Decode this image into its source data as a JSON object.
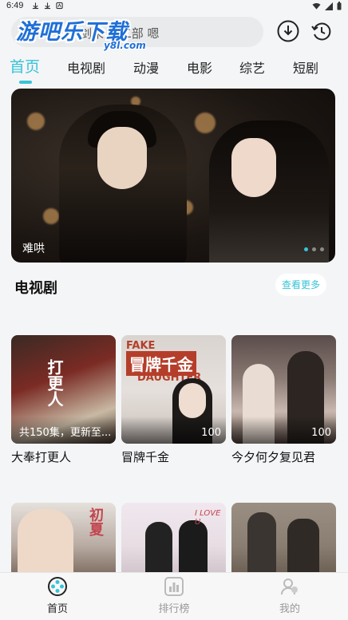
{
  "status_bar": {
    "time": "6:49"
  },
  "header": {
    "logo_text": "游吧乐下载",
    "logo_sub": "y8l.com",
    "search_placeholder": "剑来 第二部 嗯"
  },
  "tabs": [
    {
      "label": "首页",
      "active": true
    },
    {
      "label": "电视剧",
      "active": false
    },
    {
      "label": "动漫",
      "active": false
    },
    {
      "label": "电影",
      "active": false
    },
    {
      "label": "综艺",
      "active": false
    },
    {
      "label": "短剧",
      "active": false
    }
  ],
  "banner": {
    "caption": "难哄",
    "slide_index": 1,
    "slide_count": 3
  },
  "section": {
    "title": "电视剧",
    "more_label": "查看更多"
  },
  "cards": [
    {
      "title": "大奉打更人",
      "badge": "共150集，更新至...",
      "poster_text": "打更人",
      "colors": [
        "#7a2b24",
        "#c8b9a4"
      ]
    },
    {
      "title": "冒牌千金",
      "badge": "100",
      "poster_text": "冒牌千金",
      "colors": [
        "#d9d4d0",
        "#b53e2a"
      ]
    },
    {
      "title": "今夕何夕复见君",
      "badge": "100",
      "poster_text": "",
      "colors": [
        "#5a4c4a",
        "#c7b7ae"
      ]
    }
  ],
  "row2_posters": [
    {
      "colors": [
        "#e6e1dc",
        "#7f6d62"
      ],
      "poster_text": "初夏"
    },
    {
      "colors": [
        "#f1e8ef",
        "#d1c4cb"
      ],
      "poster_text": "I LOVE U"
    },
    {
      "colors": [
        "#9a8f82",
        "#6b5e52"
      ],
      "poster_text": ""
    }
  ],
  "bottom_nav": [
    {
      "label": "首页",
      "active": true,
      "icon": "film-reel-icon"
    },
    {
      "label": "排行榜",
      "active": false,
      "icon": "chart-icon"
    },
    {
      "label": "我的",
      "active": false,
      "icon": "user-icon"
    }
  ],
  "colors": {
    "accent": "#39c3d6",
    "logo": "#1f6fd6"
  }
}
